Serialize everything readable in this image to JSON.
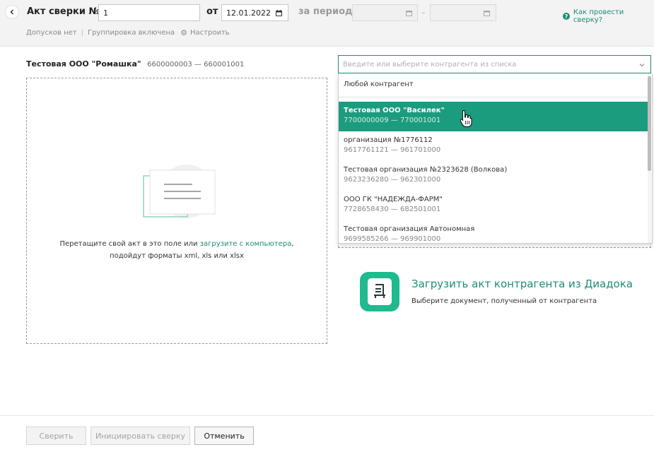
{
  "header": {
    "title": "Акт сверки №",
    "number_value": "1",
    "from_label": "от",
    "date_value": "12.01.2022",
    "period_label": "за период",
    "period_start": "",
    "period_end": "",
    "period_dash": "–",
    "help_link": "Как провести сверку?",
    "help_icon": "?",
    "tolerances": "Допусков нет",
    "separator": "|",
    "grouping": "Группировка включена",
    "settings_link": "Настроить",
    "settings_icon": "⚙"
  },
  "organization": {
    "name": "Тестовая ООО \"Ромашка\"",
    "codes": "6600000003 — 660001001"
  },
  "dropzone": {
    "text_before": "Перетащите свой акт в это поле или ",
    "link": "загрузите с компьютера",
    "text_after": ",",
    "line2": "подойдут форматы xml, xls или xlsx"
  },
  "counterparty": {
    "placeholder": "Введите или выберите контрагента из списка",
    "any_label": "Любой контрагент",
    "items": [
      {
        "name": "Тестовая ООО \"Василек\"",
        "code": "7700000009 — 770001001",
        "selected": true
      },
      {
        "name": "организация №1776112",
        "code": "9617761121 — 961701000",
        "selected": false
      },
      {
        "name": "Тестовая организация №2323628 (Волкова)",
        "code": "9623236280 — 962301000",
        "selected": false
      },
      {
        "name": "ООО ГК \"НАДЕЖДА-ФАРМ\"",
        "code": "7728658430 — 682501001",
        "selected": false
      },
      {
        "name": "Тестовая организация Автономная",
        "code": "9699585266 — 969901000",
        "selected": false
      }
    ]
  },
  "diadoc": {
    "title": "Загрузить акт контрагента из Диадока",
    "subtitle": "Выберите документ, полученный от контрагента"
  },
  "footer": {
    "verify_label": "Сверить",
    "initiate_label": "Инициировать сверку",
    "cancel_label": "Отменить"
  },
  "colors": {
    "accent": "#1c8d75",
    "selected_row": "#1c9c7e",
    "diadoc_icon": "#1fba8f"
  }
}
